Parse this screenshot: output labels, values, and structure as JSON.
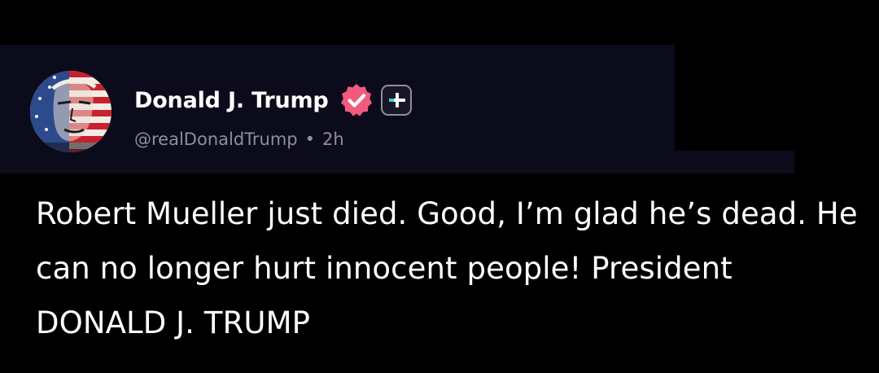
{
  "post": {
    "author": {
      "display_name": "Donald J. Trump",
      "handle": "@realDonaldTrump",
      "verified": true,
      "avatar_icon": "stars-and-stripes-portrait-avatar"
    },
    "separator": "•",
    "timestamp": "2h",
    "text": "Robert Mueller just died. Good, I’m glad he’s dead. He can no longer hurt innocent people! President DONALD J. TRUMP"
  },
  "colors": {
    "background": "#000000",
    "header_band": "#0c0b1c",
    "verified_badge": "#f25b7d",
    "meta_text": "#8e8e9e",
    "follow_accent": "#38d6c4"
  },
  "icons": {
    "verified": "verified-check-badge-icon",
    "follow": "plus-icon"
  }
}
